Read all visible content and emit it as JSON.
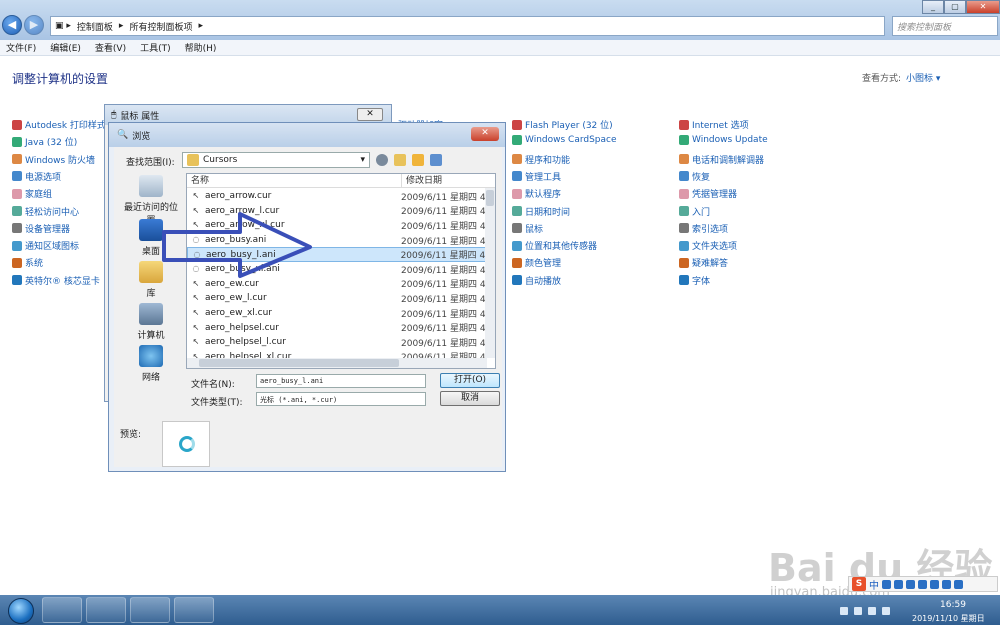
{
  "explorer": {
    "breadcrumb": [
      "控制面板",
      "所有控制面板项"
    ],
    "search_placeholder": "搜索控制面板",
    "menu": [
      "文件(F)",
      "编辑(E)",
      "查看(V)",
      "工具(T)",
      "帮助(H)"
    ],
    "heading": "调整计算机的设置",
    "view_by_label": "查看方式:",
    "view_by_value": "小图标 ▾"
  },
  "cp_items_col1": [
    "Autodesk 打印样式管理器",
    "Java (32 位)",
    "Windows 防火墙",
    "电源选项",
    "家庭组",
    "轻松访问中心",
    "设备管理器",
    "通知区域图标",
    "系统",
    "英特尔® 核芯显卡"
  ],
  "cp_items_col3": [
    "Flash Player (32 位)",
    "Windows CardSpace",
    "程序和功能",
    "管理工具",
    "默认程序",
    "日期和时间",
    "鼠标",
    "位置和其他传感器",
    "颜色管理",
    "自动播放"
  ],
  "cp_items_col4": [
    "Internet 选项",
    "Windows Update",
    "电话和调制解调器",
    "恢复",
    "凭据管理器",
    "入门",
    "索引选项",
    "文件夹选项",
    "疑难解答",
    "字体"
  ],
  "cp_partial_behind": "驱动器加密",
  "mouse_props": {
    "title": "鼠标 属性"
  },
  "browse": {
    "title": "浏览",
    "lookin_label": "查找范围(I):",
    "lookin_value": "Cursors",
    "places": [
      "最近访问的位置",
      "桌面",
      "库",
      "计算机",
      "网络"
    ],
    "columns": [
      "名称",
      "修改日期"
    ],
    "files": [
      {
        "name": "aero_arrow.cur",
        "date": "2009/6/11 星期四 4..."
      },
      {
        "name": "aero_arrow_l.cur",
        "date": "2009/6/11 星期四 4..."
      },
      {
        "name": "aero_arrow_xl.cur",
        "date": "2009/6/11 星期四 4..."
      },
      {
        "name": "aero_busy.ani",
        "date": "2009/6/11 星期四 4..."
      },
      {
        "name": "aero_busy_l.ani",
        "date": "2009/6/11 星期四 4..."
      },
      {
        "name": "aero_busy_xl.ani",
        "date": "2009/6/11 星期四 4..."
      },
      {
        "name": "aero_ew.cur",
        "date": "2009/6/11 星期四 4..."
      },
      {
        "name": "aero_ew_l.cur",
        "date": "2009/6/11 星期四 4..."
      },
      {
        "name": "aero_ew_xl.cur",
        "date": "2009/6/11 星期四 4..."
      },
      {
        "name": "aero_helpsel.cur",
        "date": "2009/6/11 星期四 4..."
      },
      {
        "name": "aero_helpsel_l.cur",
        "date": "2009/6/11 星期四 4..."
      },
      {
        "name": "aero_helpsel_xl.cur",
        "date": "2009/6/11 星期四 4..."
      }
    ],
    "selected_index": 4,
    "filename_label": "文件名(N):",
    "filename_value": "aero_busy_l.ani",
    "filetype_label": "文件类型(T):",
    "filetype_value": "光标 (*.ani, *.cur)",
    "open_label": "打开(O)",
    "cancel_label": "取消",
    "preview_label": "预览:"
  },
  "taskbar": {
    "time": "16:59",
    "date": "2019/11/10 星期日"
  },
  "ime": {
    "logo": "S",
    "lang": "中"
  },
  "watermark": {
    "text": "Bai du 经验",
    "url": "jingyan.baidu.com"
  },
  "colors": {
    "link": "#1a5fb4",
    "selection": "#cde6fb",
    "arrow": "#3a4fb8"
  }
}
